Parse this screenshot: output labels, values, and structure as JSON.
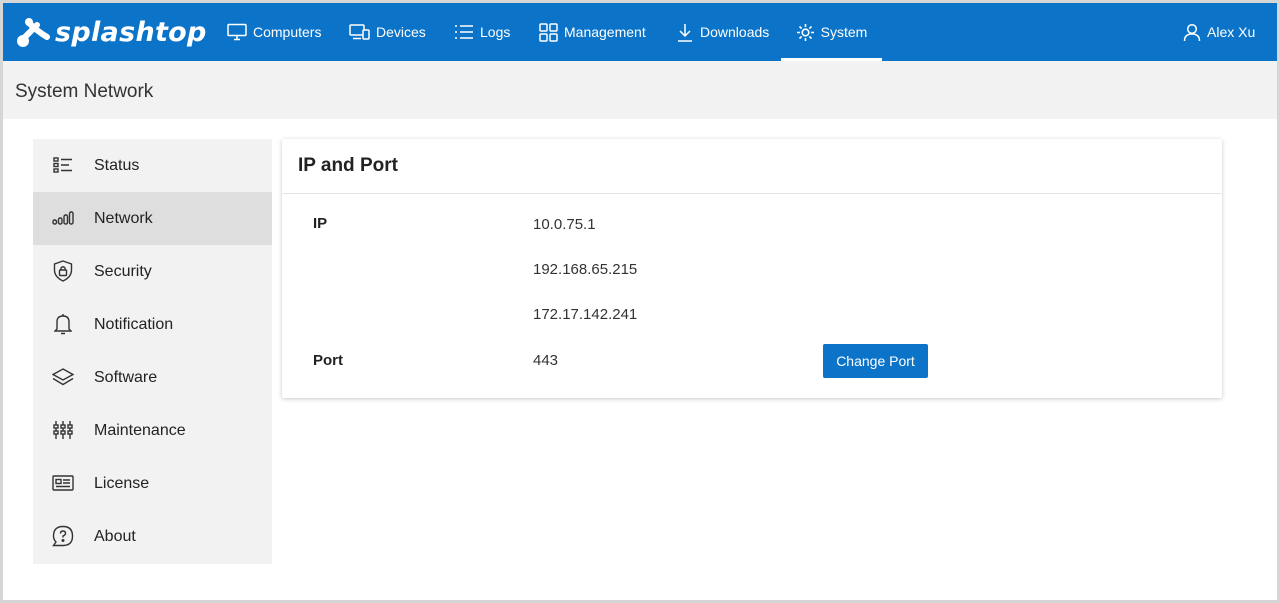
{
  "brand": {
    "name": "splashtop",
    "logo_icon": "splashtop-logo-icon"
  },
  "nav": {
    "items": [
      {
        "label": "Computers",
        "icon": "monitor-icon"
      },
      {
        "label": "Devices",
        "icon": "devices-icon"
      },
      {
        "label": "Logs",
        "icon": "list-icon"
      },
      {
        "label": "Management",
        "icon": "grid-icon"
      },
      {
        "label": "Downloads",
        "icon": "download-icon"
      },
      {
        "label": "System",
        "icon": "gear-icon",
        "active": true
      }
    ],
    "user": {
      "label": "Alex Xu",
      "icon": "user-icon"
    }
  },
  "page": {
    "title": "System Network"
  },
  "sidebar": {
    "items": [
      {
        "label": "Status",
        "icon": "status-list-icon"
      },
      {
        "label": "Network",
        "icon": "signal-bars-icon",
        "active": true
      },
      {
        "label": "Security",
        "icon": "shield-lock-icon"
      },
      {
        "label": "Notification",
        "icon": "bell-icon"
      },
      {
        "label": "Software",
        "icon": "layers-icon"
      },
      {
        "label": "Maintenance",
        "icon": "sliders-icon"
      },
      {
        "label": "License",
        "icon": "id-card-icon"
      },
      {
        "label": "About",
        "icon": "question-bubble-icon"
      }
    ]
  },
  "card": {
    "title": "IP and Port",
    "ip_label": "IP",
    "ips": [
      "10.0.75.1",
      "192.168.65.215",
      "172.17.142.241"
    ],
    "port_label": "Port",
    "port_value": "443",
    "change_port_button": "Change Port"
  },
  "colors": {
    "brand_blue": "#0b74c8",
    "sidebar_bg": "#f2f2f2",
    "sidebar_active_bg": "#dedede"
  }
}
